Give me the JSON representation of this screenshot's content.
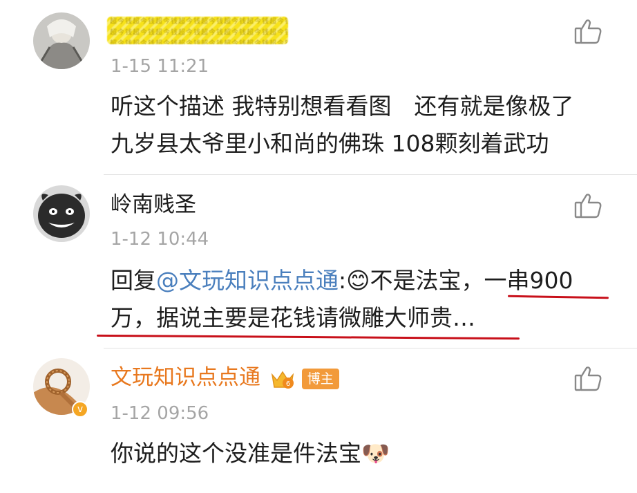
{
  "comments": [
    {
      "username": "",
      "censor_text": "超今钱超今钱超今钱超今钱超今钱超今钱超今钱超今钱超今钱超今钱",
      "time": "1-15 11:21",
      "line1": "听这个描述 我特别想看看图　还有就是像极了",
      "line2": "九岁县太爷里小和尚的佛珠 108颗刻着武功"
    },
    {
      "username": "岭南贱圣",
      "time": "1-12 10:44",
      "reply_prefix": "回复",
      "mention": "@文玩知识点点通",
      "after_mention": ":😊不是法宝，",
      "highlight": "一串900",
      "line2": "万，据说主要是花钱请微雕大师贵…"
    },
    {
      "username": "文玩知识点点通",
      "badge": "博主",
      "time": "1-12 09:56",
      "text": "你说的这个没准是件法宝🐶"
    }
  ],
  "colors": {
    "mention": "#4a7fbd",
    "orange_name": "#e8781e",
    "time": "#a5a5a5",
    "underline": "#c8101a",
    "badge": "#f29a3a"
  },
  "icons": [
    "thumbs-up-icon",
    "crown-level-icon",
    "verified-icon"
  ]
}
